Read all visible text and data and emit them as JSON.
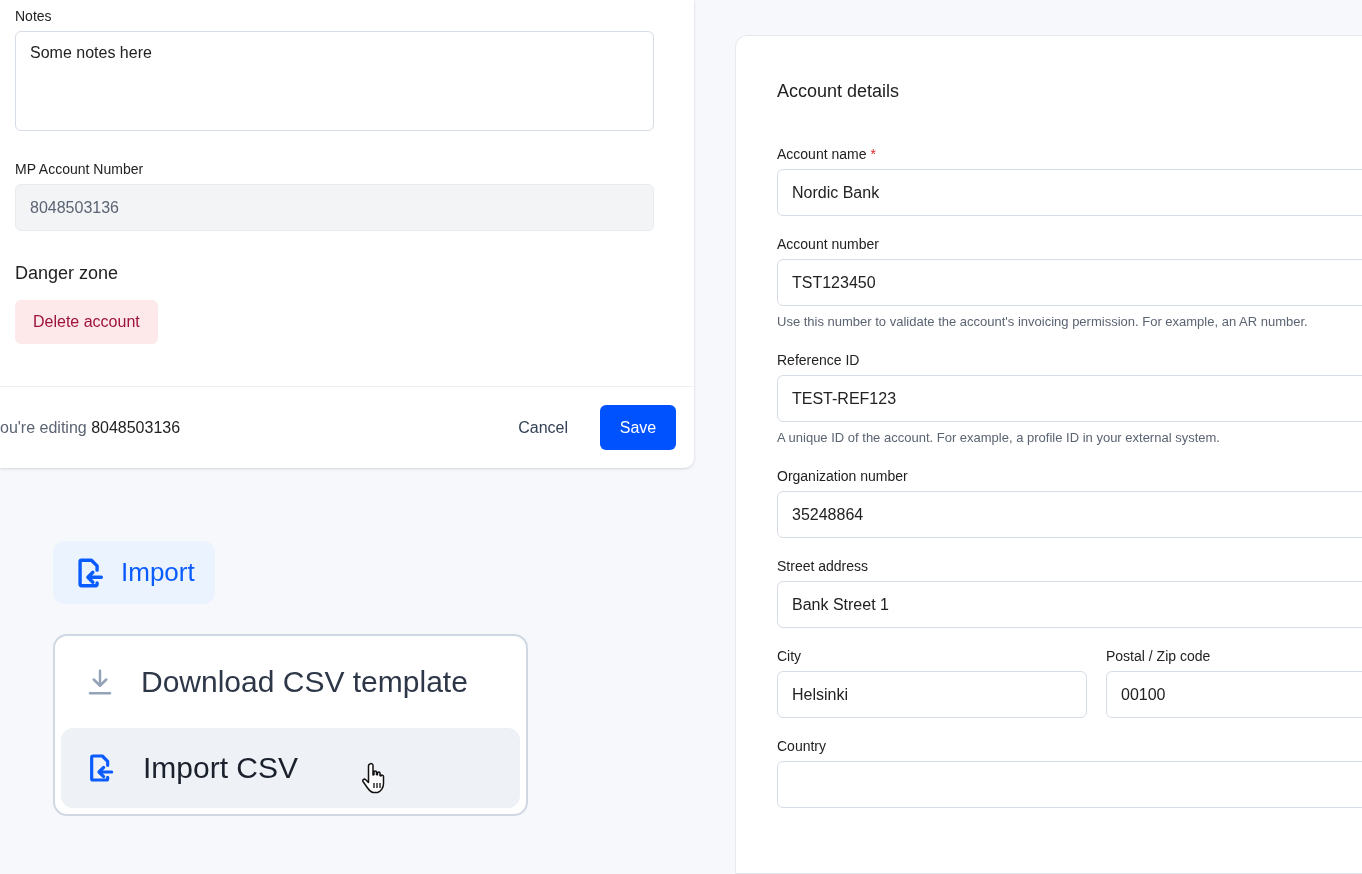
{
  "edit_card": {
    "fields": [
      {
        "label": "Notes",
        "kind": "textarea",
        "value": "Some notes here",
        "disabled": false
      },
      {
        "label": "MP Account Number",
        "kind": "input",
        "value": "8048503136",
        "disabled": true
      }
    ],
    "danger_zone": {
      "title": "Danger zone",
      "button": "Delete account"
    },
    "footer": {
      "text": "ou're editing **8048503136**",
      "cancel": "Cancel",
      "save": "Save"
    }
  },
  "import": {
    "button": "Import",
    "menu": [
      {
        "label": "Download CSV template",
        "kind": "download",
        "hovered": false
      },
      {
        "label": "Import CSV",
        "kind": "import",
        "hovered": true
      }
    ]
  },
  "account_details": {
    "title": "Account details",
    "rows": [
      [
        {
          "label": "Account name",
          "required_mark": "*",
          "value": "Nordic Bank"
        }
      ],
      [
        {
          "label": "Account number",
          "value": "TST123450",
          "help": "Use this number to validate the account's invoicing permission. For example, an AR number."
        }
      ],
      [
        {
          "label": "Reference ID",
          "value": "TEST-REF123",
          "help": "A unique ID of the account. For example, a profile ID in your external system."
        }
      ],
      [
        {
          "label": "Organization number",
          "value": "35248864"
        }
      ],
      [
        {
          "label": "Street address",
          "value": "Bank Street 1"
        }
      ],
      [
        {
          "label": "City",
          "value": "Helsinki"
        },
        {
          "label": "Postal / Zip code",
          "value": "00100"
        }
      ],
      [
        {
          "label": "Country"
        }
      ]
    ]
  }
}
